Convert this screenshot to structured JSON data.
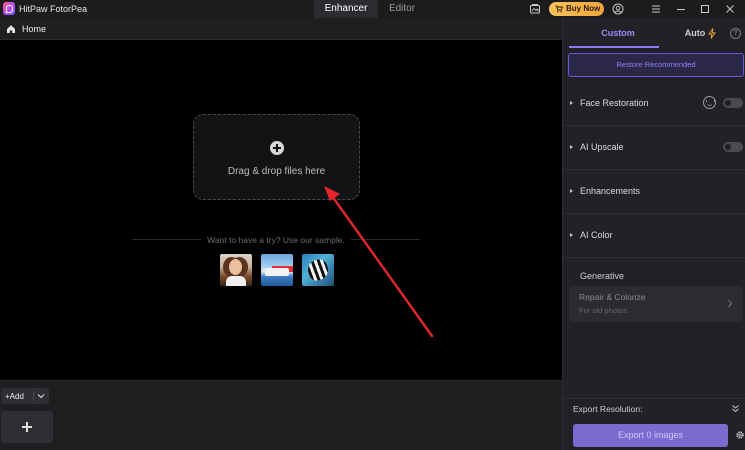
{
  "window": {
    "title": "HitPaw FotorPea",
    "tabs": [
      {
        "label": "Enhancer",
        "active": true
      },
      {
        "label": "Editor",
        "active": false
      }
    ],
    "buy_label": "Buy Now",
    "accent": "#8a78ff"
  },
  "breadcrumb": {
    "home_label": "Home"
  },
  "canvas": {
    "drop_text": "Drag & drop files here",
    "try_text": "Want to have a try? Use our sample.",
    "samples": [
      "portrait-sample",
      "cruise-ship-sample",
      "zebra-fish-sample"
    ]
  },
  "bottom": {
    "add_label": "Add"
  },
  "panel": {
    "tabs": {
      "custom": "Custom",
      "auto": "Auto"
    },
    "restore_label": "Restore Recommended",
    "sections": [
      {
        "label": "Face Restoration",
        "toggle": false
      },
      {
        "label": "AI Upscale",
        "toggle": false
      },
      {
        "label": "Enhancements"
      },
      {
        "label": "AI Color"
      }
    ],
    "generative_label": "Generative",
    "repair": {
      "title": "Repair & Colorize",
      "subtitle": "For old photos"
    },
    "export_resolution_label": "Export Resolution:",
    "export_button": "Export 0 images"
  }
}
